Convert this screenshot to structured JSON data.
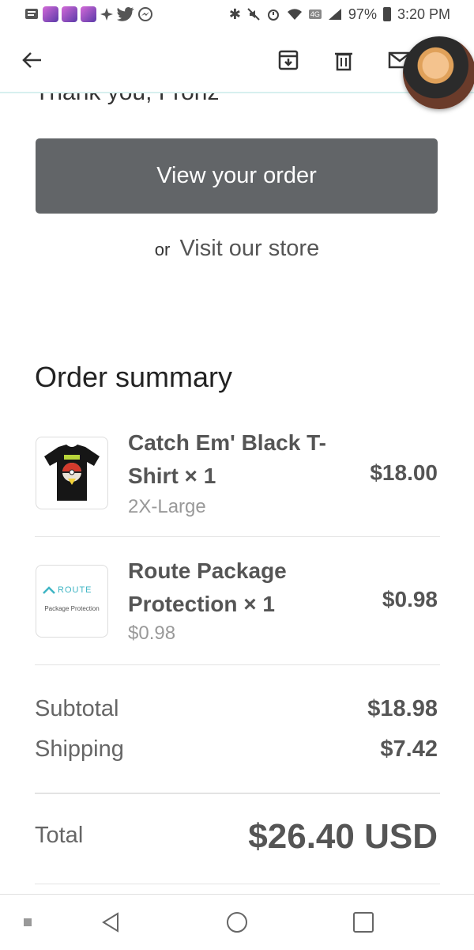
{
  "status_bar": {
    "battery": "97%",
    "time": "3:20 PM",
    "network": "4G"
  },
  "header": {
    "back_icon": "back-arrow-icon",
    "archive_icon": "archive-icon",
    "delete_icon": "trash-icon",
    "mail_icon": "mail-icon"
  },
  "content": {
    "partial_heading": "Thank you, Fronz",
    "view_order_label": "View your order",
    "or_label": "or",
    "visit_store_label": "Visit our store",
    "summary_title": "Order summary",
    "items": [
      {
        "name": "Catch Em' Black T-Shirt × 1",
        "variant": "2X-Large",
        "price": "$18.00"
      },
      {
        "name": "Route Package Protection × 1",
        "variant": "$0.98",
        "price": "$0.98",
        "logo_text": "ROUTE",
        "logo_sub": "Package Protection"
      }
    ],
    "subtotal_label": "Subtotal",
    "subtotal_value": "$18.98",
    "shipping_label": "Shipping",
    "shipping_value": "$7.42",
    "total_label": "Total",
    "total_value": "$26.40 USD"
  },
  "colors": {
    "button": "#626568",
    "route_accent": "#3fb5c4",
    "header_border": "#d7f0ef"
  }
}
